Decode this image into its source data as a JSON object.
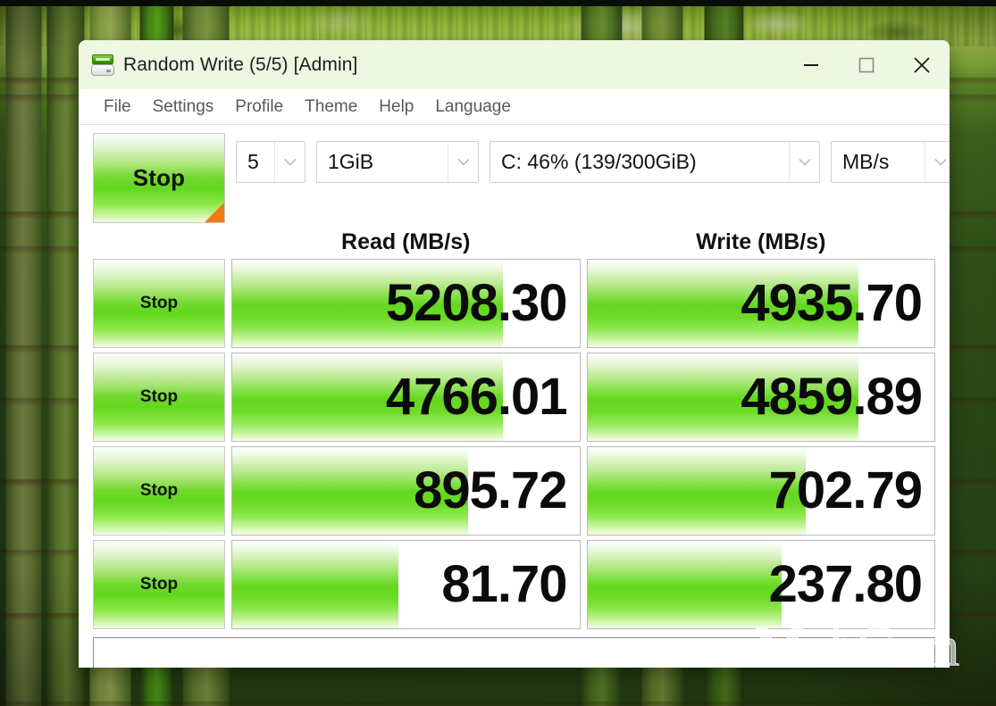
{
  "window": {
    "title": "Random Write (5/5) [Admin]",
    "app_icon": "disk-drive-icon",
    "controls": {
      "minimize": "minimize-icon",
      "maximize": "maximize-icon",
      "close": "close-icon"
    }
  },
  "menu": {
    "items": [
      {
        "label": "File"
      },
      {
        "label": "Settings"
      },
      {
        "label": "Profile"
      },
      {
        "label": "Theme"
      },
      {
        "label": "Help"
      },
      {
        "label": "Language"
      }
    ]
  },
  "toolbar": {
    "run_button_label": "Stop",
    "run_count": "5",
    "test_size": "1GiB",
    "target_drive": "C: 46% (139/300GiB)",
    "unit": "MB/s",
    "dropdown_arrow_icon": "chevron-down-icon"
  },
  "results": {
    "headers": {
      "read": "Read (MB/s)",
      "write": "Write (MB/s)"
    },
    "rows": [
      {
        "stop_label": "Stop",
        "read": "5208.30",
        "write": "4935.70",
        "read_fill_pct": 78,
        "write_fill_pct": 78
      },
      {
        "stop_label": "Stop",
        "read": "4766.01",
        "write": "4859.89",
        "read_fill_pct": 78,
        "write_fill_pct": 78
      },
      {
        "stop_label": "Stop",
        "read": "895.72",
        "write": "702.79",
        "read_fill_pct": 68,
        "write_fill_pct": 63
      },
      {
        "stop_label": "Stop",
        "read": "81.70",
        "write": "237.80",
        "read_fill_pct": 48,
        "write_fill_pct": 56
      }
    ]
  },
  "statusbar": {
    "text": ""
  },
  "watermark": {
    "text": "MobGsm"
  },
  "colors": {
    "accent_green": "#63d71f",
    "titlebar": "#eef7e2",
    "corner_marker": "#f07a12",
    "value_text": "#0b0b0b"
  }
}
